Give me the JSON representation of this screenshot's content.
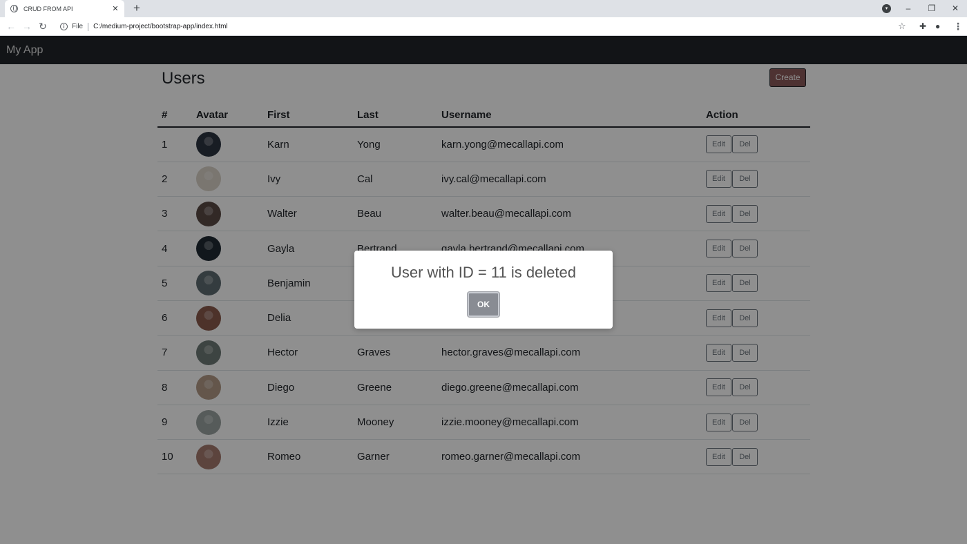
{
  "browser": {
    "tab_title": "CRUD FROM API",
    "scheme": "File",
    "url": "C:/medium-project/bootstrap-app/index.html"
  },
  "navbar": {
    "brand": "My App"
  },
  "main": {
    "heading": "Users",
    "create_label": "Create",
    "columns": [
      "#",
      "Avatar",
      "First",
      "Last",
      "Username",
      "Action"
    ],
    "edit_label": "Edit",
    "del_label": "Del",
    "rows": [
      {
        "id": "1",
        "first": "Karn",
        "last": "Yong",
        "username": "karn.yong@mecallapi.com",
        "avatar_color": "#2b3440"
      },
      {
        "id": "2",
        "first": "Ivy",
        "last": "Cal",
        "username": "ivy.cal@mecallapi.com",
        "avatar_color": "#d9d2c8"
      },
      {
        "id": "3",
        "first": "Walter",
        "last": "Beau",
        "username": "walter.beau@mecallapi.com",
        "avatar_color": "#5a4a45"
      },
      {
        "id": "4",
        "first": "Gayla",
        "last": "Bertrand",
        "username": "gayla.bertrand@mecallapi.com",
        "avatar_color": "#1f2a33"
      },
      {
        "id": "5",
        "first": "Benjamin",
        "last": "",
        "username": "",
        "avatar_color": "#5e6b70"
      },
      {
        "id": "6",
        "first": "Delia",
        "last": "",
        "username": "",
        "avatar_color": "#8a5a4c"
      },
      {
        "id": "7",
        "first": "Hector",
        "last": "Graves",
        "username": "hector.graves@mecallapi.com",
        "avatar_color": "#6d7a76"
      },
      {
        "id": "8",
        "first": "Diego",
        "last": "Greene",
        "username": "diego.greene@mecallapi.com",
        "avatar_color": "#b29a86"
      },
      {
        "id": "9",
        "first": "Izzie",
        "last": "Mooney",
        "username": "izzie.mooney@mecallapi.com",
        "avatar_color": "#9aa3a0"
      },
      {
        "id": "10",
        "first": "Romeo",
        "last": "Garner",
        "username": "romeo.garner@mecallapi.com",
        "avatar_color": "#a57a6e"
      }
    ]
  },
  "modal": {
    "title": "User with ID = 11 is deleted",
    "ok_label": "OK"
  },
  "colors": {
    "navbar_bg": "#212529",
    "backdrop": "rgba(0,0,0,0.44)",
    "ok_button": "#898c93"
  }
}
